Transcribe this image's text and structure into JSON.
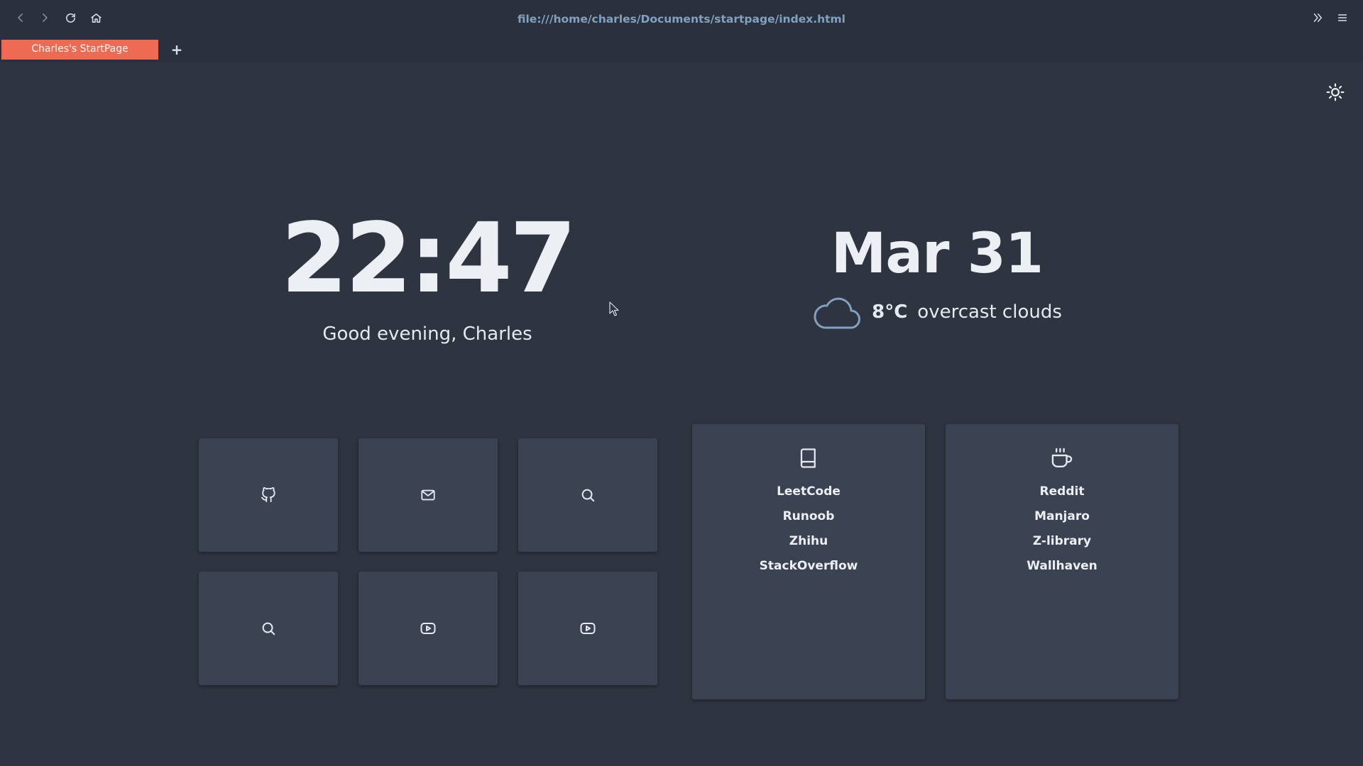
{
  "browser": {
    "url": "file:///home/charles/Documents/startpage/index.html",
    "tab_title": "Charles's StartPage",
    "new_tab_label": "+",
    "icons": {
      "back": "chevron-left-icon",
      "forward": "chevron-right-icon",
      "reload": "reload-icon",
      "home": "home-icon",
      "overflow": "double-chevron-right-icon",
      "menu": "hamburger-menu-icon"
    }
  },
  "page": {
    "theme_toggle_icon": "sun-icon",
    "clock": "22:47",
    "greeting": "Good evening, Charles",
    "date": "Mar 31",
    "weather": {
      "icon": "cloud-icon",
      "temperature": "8°C",
      "description": "overcast clouds"
    },
    "shortcuts": [
      {
        "icon": "github-icon"
      },
      {
        "icon": "mail-icon"
      },
      {
        "icon": "search-icon"
      },
      {
        "icon": "search-icon"
      },
      {
        "icon": "youtube-icon"
      },
      {
        "icon": "youtube-icon"
      }
    ],
    "link_cards": [
      {
        "icon": "book-icon",
        "links": [
          "LeetCode",
          "Runoob",
          "Zhihu",
          "StackOverflow"
        ]
      },
      {
        "icon": "coffee-cup-icon",
        "links": [
          "Reddit",
          "Manjaro",
          "Z-library",
          "Wallhaven"
        ]
      }
    ]
  },
  "colors": {
    "background": "#2e3440",
    "chrome": "#2b313c",
    "tile": "#3b4252",
    "accent_tab": "#ed6a53",
    "url_text": "#81a1c1",
    "icon_stroke": "#e5e9f0",
    "cloud_stroke": "#81a1c1"
  }
}
